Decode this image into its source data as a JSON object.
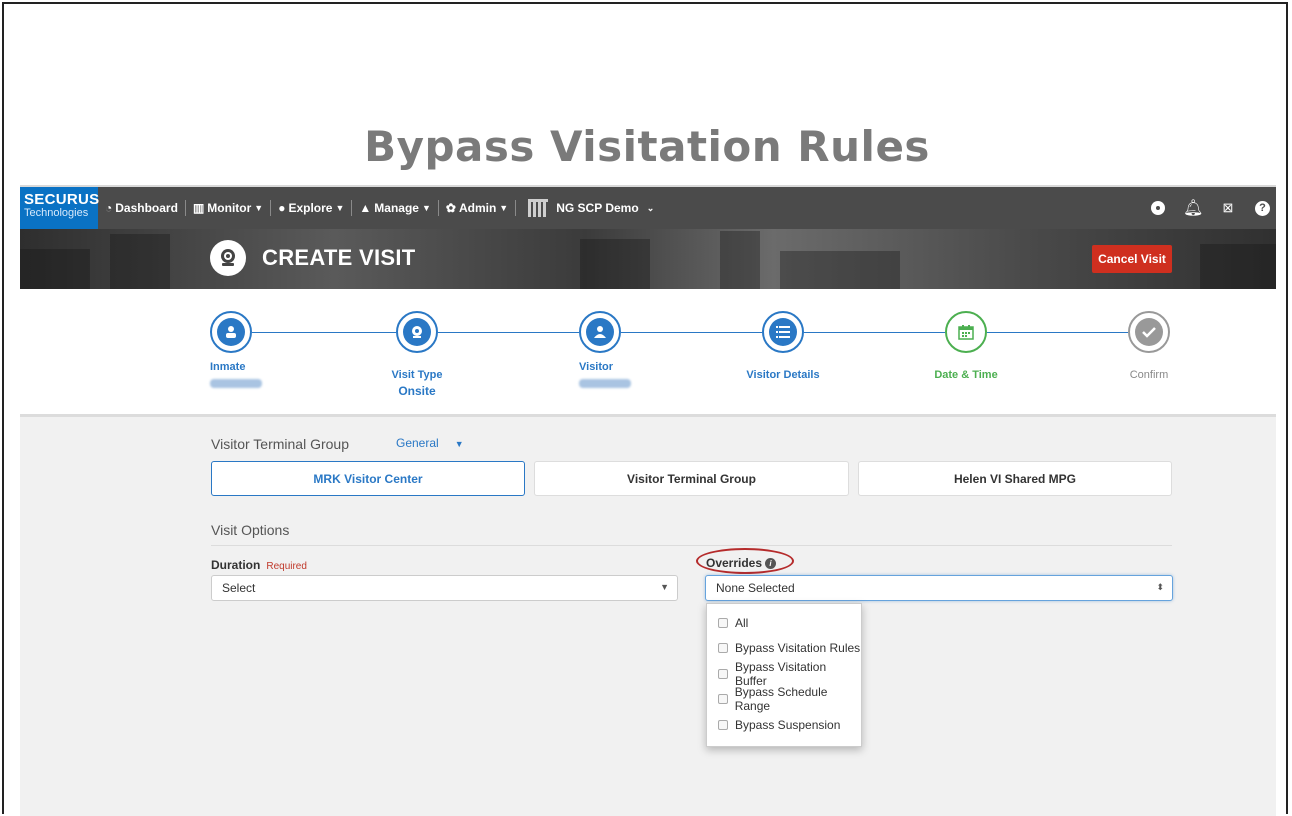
{
  "slide": {
    "title": "Bypass Visitation Rules"
  },
  "nav": {
    "brand_line1": "SECURUS",
    "brand_line2": "Technologies",
    "items": [
      {
        "label": "Dashboard",
        "icon": "dashboard-icon"
      },
      {
        "label": "Monitor",
        "icon": "chart-icon"
      },
      {
        "label": "Explore",
        "icon": "globe-icon"
      },
      {
        "label": "Manage",
        "icon": "user-icon"
      },
      {
        "label": "Admin",
        "icon": "gear-icon"
      }
    ],
    "facility": "NG SCP Demo"
  },
  "header": {
    "title": "CREATE VISIT",
    "cancel_label": "Cancel Visit"
  },
  "steps": [
    {
      "label": "Inmate",
      "icon": "inmate-icon"
    },
    {
      "label": "Visit Type",
      "value": "Onsite",
      "icon": "webcam-icon"
    },
    {
      "label": "Visitor",
      "icon": "visitor-icon"
    },
    {
      "label": "Visitor Details",
      "icon": "list-icon"
    },
    {
      "label": "Date & Time",
      "icon": "calendar-icon"
    },
    {
      "label": "Confirm",
      "icon": "check-icon"
    }
  ],
  "terminal_group": {
    "label": "Visitor Terminal Group",
    "selected": "General",
    "options": [
      "MRK Visitor Center",
      "Visitor Terminal Group",
      "Helen VI Shared MPG"
    ]
  },
  "visit_options": {
    "label": "Visit Options",
    "duration_label": "Duration",
    "required_label": "Required",
    "duration_value": "Select",
    "overrides_label": "Overrides",
    "overrides_value": "None Selected",
    "override_options": [
      "All",
      "Bypass Visitation Rules",
      "Bypass Visitation Buffer",
      "Bypass Schedule Range",
      "Bypass Suspension"
    ]
  },
  "colors": {
    "brand": "#0a72c4",
    "accent": "#2a78c5",
    "danger": "#cf2f1f",
    "success": "#4caf50"
  }
}
